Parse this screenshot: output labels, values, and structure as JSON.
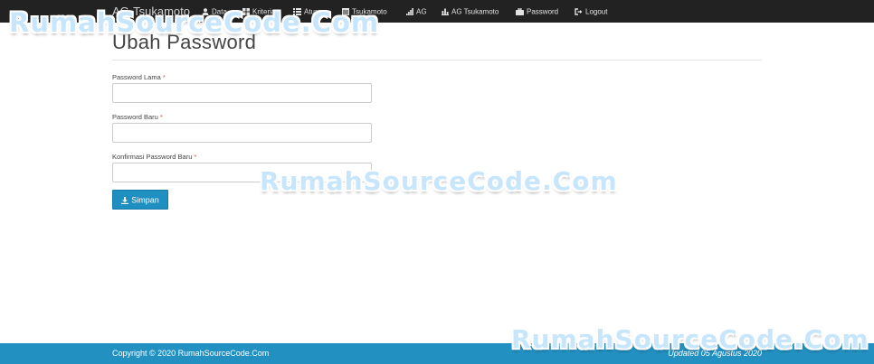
{
  "navbar": {
    "brand": "AG-Tsukamoto",
    "items": [
      {
        "label": "Data",
        "icon": "user-icon"
      },
      {
        "label": "Kriteria",
        "icon": "grid-icon"
      },
      {
        "label": "Aturan",
        "icon": "list-icon"
      },
      {
        "label": "Tsukamoto",
        "icon": "table-icon"
      },
      {
        "label": "AG",
        "icon": "signal-icon"
      },
      {
        "label": "AG Tsukamoto",
        "icon": "bar-chart-icon"
      },
      {
        "label": "Password",
        "icon": "briefcase-icon"
      },
      {
        "label": "Logout",
        "icon": "logout-icon"
      }
    ]
  },
  "watermark": "RumahSourceCode.Com",
  "page": {
    "title": "Ubah Password"
  },
  "form": {
    "old_password": {
      "label": "Password Lama",
      "required": "*",
      "value": ""
    },
    "new_password": {
      "label": "Password Baru",
      "required": "*",
      "value": ""
    },
    "confirm_password": {
      "label": "Konfirmasi Password Baru",
      "required": "*",
      "value": ""
    },
    "submit_label": "Simpan",
    "submit_icon": "download-icon"
  },
  "footer": {
    "copyright": "Copyright © 2020 RumahSourceCode.Com",
    "updated": "Updated 05 Agustus 2020"
  },
  "colors": {
    "navbar": "#222222",
    "primary": "#1f8fc1",
    "footer": "#2290c1",
    "required": "#d9534f"
  }
}
